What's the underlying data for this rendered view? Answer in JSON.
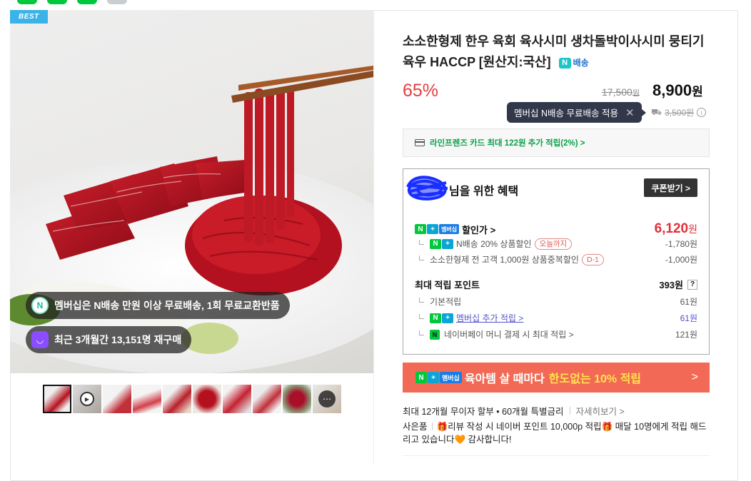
{
  "hero": {
    "badge": "BEST",
    "overlay_1": "멤버십은 N배송 만원 이상 무료배송, 1회 무료교환반품",
    "overlay_2": "최근 3개월간 13,151명 재구매"
  },
  "product": {
    "title": "소소한형제 한우 육회 육사시미 생차돌박이사시미 뭉티기 육우 HACCP [원산지:국산]",
    "delivery_badge": "배송",
    "discount_rate": "65%",
    "original_price": "17,500",
    "original_unit": "원",
    "sale_price": "8,900",
    "sale_unit": "원",
    "shipping_tooltip": "멤버십 N배송 무료배송 적용",
    "shipping_fee": "3,500원"
  },
  "card_benefit": "라인프렌즈 카드 최대 122원 추가 적립(2%) >",
  "benefits": {
    "title": "님을 위한 혜택",
    "coupon_button": "쿠폰받기 >",
    "member_price_label": "할인가 >",
    "member_price_value": "6,120",
    "member_price_unit": "원",
    "discounts": [
      {
        "label": "N배송 20% 상품할인",
        "tag": "오늘까지",
        "value": "-1,780원"
      },
      {
        "label": "소소한형제 전 고객 1,000원 상품중복할인",
        "tag": "D-1",
        "value": "-1,000원"
      }
    ],
    "points_label": "최대 적립 포인트",
    "points_value": "393원",
    "points": [
      {
        "label": "기본적립",
        "value": "61원"
      },
      {
        "label": "멤버십 추가 적립 >",
        "value": "61원"
      },
      {
        "label": "네이버페이 머니 결제 시 최대 적립 >",
        "value": "121원"
      }
    ]
  },
  "banner": {
    "membership": "멤버십",
    "text": "육아템 살 때마다",
    "highlight": "한도없는 10% 적립",
    "arrow": ">"
  },
  "installment": {
    "text": "최대 12개월 무이자 할부 • 60개월 특별금리",
    "more": "자세히보기 >"
  },
  "gift": {
    "label": "사은품",
    "text": "🎁리뷰 작성 시 네이버 포인트 10,000p 적립🎁 매달 10명에게 적립 해드리고 있습니다🧡 감사합니다!"
  },
  "colors": {
    "discount_red": "#e43e3e",
    "naver_green": "#00c73c",
    "banner_orange": "#f26a55",
    "tooltip_navy": "#32384a"
  }
}
